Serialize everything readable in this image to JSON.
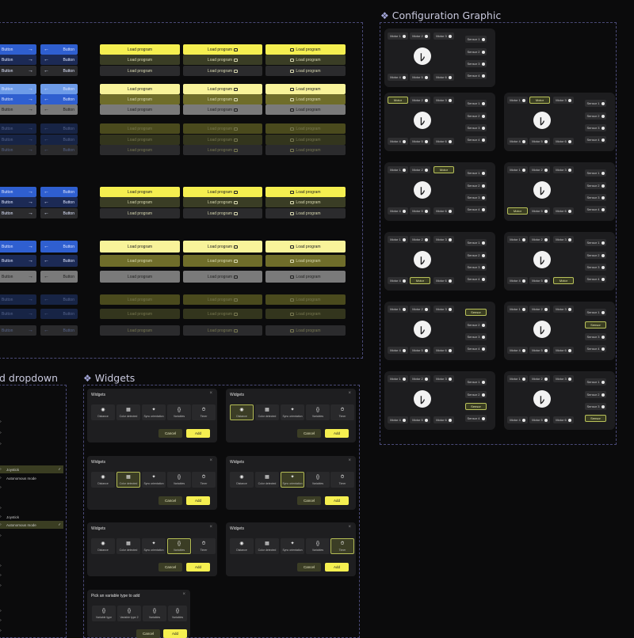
{
  "sections": {
    "configuration_title": "Configuration Graphic",
    "widgets_title": "Widgets",
    "dropdown_title": "d dropdown"
  },
  "buttons": {
    "primary_label": "Button",
    "load_program_label": "Load program"
  },
  "config": {
    "motor_labels": [
      "Motor 1",
      "Motor 2",
      "Motor 3",
      "Motor 4",
      "Motor 5",
      "Motor 6"
    ],
    "sensor_labels": [
      "Sensor 1",
      "Sensor 2",
      "Sensor 3",
      "Sensor 4"
    ],
    "selected_motor_label": "Motor",
    "selected_sensor_label": "Sensor"
  },
  "widgets": {
    "panel_title": "Widgets",
    "tiles": [
      "Distance",
      "Color detected",
      "Sync orientation",
      "Variables",
      "Timer"
    ],
    "cancel_label": "Cancel",
    "add_label": "Add",
    "variable_panel_title": "Pick an variable type to add",
    "variable_tiles": [
      "Variable type",
      "Variable type 2",
      "Variables",
      "Variables"
    ]
  },
  "dropdown": {
    "item_joystick": "Joystick",
    "item_autonomous": "Autonomous mode"
  },
  "icons": {
    "arrow_right": "arrow-right-icon",
    "arrow_left": "arrow-left-icon",
    "folder": "folder-icon",
    "close": "close-icon",
    "check": "check-icon",
    "chevron": "chevron-right-icon",
    "logo": "robot-logo-icon"
  },
  "colors": {
    "blue": "#2f5fd0",
    "yellow": "#f5ef50",
    "olive": "#3b3d25",
    "accent_border": "#b9c25a"
  }
}
